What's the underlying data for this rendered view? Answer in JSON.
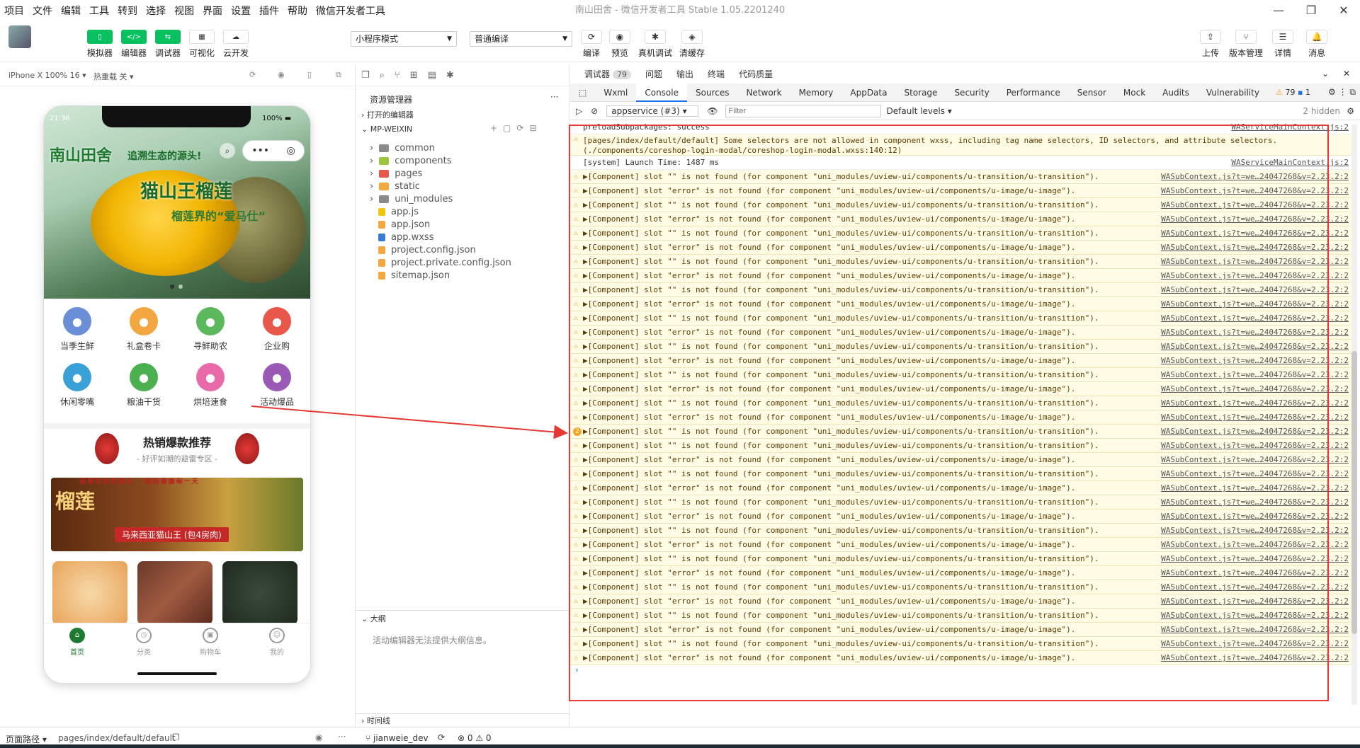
{
  "menu": {
    "items": [
      "项目",
      "文件",
      "编辑",
      "工具",
      "转到",
      "选择",
      "视图",
      "界面",
      "设置",
      "插件",
      "帮助",
      "微信开发者工具"
    ]
  },
  "window": {
    "title": "南山田舍 - 微信开发者工具 Stable 1.05.2201240"
  },
  "toolbar": {
    "left_buttons": [
      "模拟器",
      "编辑器",
      "调试器",
      "可视化",
      "云开发"
    ],
    "mode_select": "小程序模式",
    "compile_select": "普通编译",
    "mid_buttons": [
      "编译",
      "预览",
      "真机调试",
      "清缓存"
    ],
    "right_buttons": [
      "上传",
      "版本管理",
      "详情",
      "消息"
    ]
  },
  "simulator": {
    "device": "iPhone X 100% 16 ▾",
    "hotreload": "热重载 关 ▾",
    "status_time": "21:36",
    "battery": "100%",
    "logo": "南山田舍",
    "slogan": "追溯生态的源头!",
    "product_title": "猫山王榴莲",
    "product_sub": "榴莲界的“爱马仕”",
    "categories": [
      {
        "label": "当季生鲜",
        "color": "#6b8fd6"
      },
      {
        "label": "礼盒卷卡",
        "color": "#f4a640"
      },
      {
        "label": "寻鲜助农",
        "color": "#5cb85c"
      },
      {
        "label": "企业购",
        "color": "#e8574a"
      },
      {
        "label": "休闲零嘴",
        "color": "#3aa0d8"
      },
      {
        "label": "粮油干货",
        "color": "#4caf50"
      },
      {
        "label": "烘培速食",
        "color": "#e86aa8"
      },
      {
        "label": "活动爆品",
        "color": "#9b59b6"
      }
    ],
    "hot_title": "热销爆款推荐",
    "hot_sub": "- 好评如潮的避雷专区 -",
    "promo_top": "追溯生态的源头 · 链接健康每一天",
    "promo_big": "榴莲",
    "promo_tag": "马来西亚猫山王 (包4房肉)",
    "tabs": [
      "首页",
      "分类",
      "购物车",
      "我的"
    ]
  },
  "explorer": {
    "title": "资源管理器",
    "open_editors": "打开的编辑器",
    "root": "MP-WEIXIN",
    "files": [
      {
        "name": "common",
        "type": "folder",
        "color": "#8a8a8a"
      },
      {
        "name": "components",
        "type": "folder",
        "color": "#9bc53d"
      },
      {
        "name": "pages",
        "type": "folder",
        "color": "#e8574a"
      },
      {
        "name": "static",
        "type": "folder",
        "color": "#f4a640"
      },
      {
        "name": "uni_modules",
        "type": "folder",
        "color": "#8a8a8a"
      },
      {
        "name": "app.js",
        "type": "file",
        "color": "#f1c40f"
      },
      {
        "name": "app.json",
        "type": "file",
        "color": "#f4a640"
      },
      {
        "name": "app.wxss",
        "type": "file",
        "color": "#3a7bd5"
      },
      {
        "name": "project.config.json",
        "type": "file",
        "color": "#f4a640"
      },
      {
        "name": "project.private.config.json",
        "type": "file",
        "color": "#f4a640"
      },
      {
        "name": "sitemap.json",
        "type": "file",
        "color": "#f4a640"
      }
    ],
    "outline": "大纲",
    "outline_msg": "活动编辑器无法提供大纲信息。",
    "timeline": "时间线"
  },
  "devtools": {
    "top_tabs": [
      "调试器",
      "问题",
      "输出",
      "终端",
      "代码质量"
    ],
    "debugger_count": "79",
    "tabs": [
      "Wxml",
      "Console",
      "Sources",
      "Network",
      "Memory",
      "AppData",
      "Storage",
      "Security",
      "Performance",
      "Sensor",
      "Mock",
      "Audits",
      "Vulnerability"
    ],
    "active_tab": "Console",
    "warn_count": "79",
    "info_count": "1",
    "context": "appservice (#3)",
    "filter_placeholder": "Filter",
    "levels": "Default levels ▾",
    "hidden": "2 hidden",
    "lines": [
      {
        "kind": "info",
        "text": "preloadSubpackages: success",
        "src": "WAServiceMainContext.js:2"
      },
      {
        "kind": "warn_tall",
        "text": "[pages/index/default/default] Some selectors are not allowed in component wxss, including tag name selectors, ID selectors, and attribute selectors.(./components/coreshop-login-modal/coreshop-login-modal.wxss:140:12)",
        "src": ""
      },
      {
        "kind": "info",
        "text": "[system] Launch Time: 1487 ms",
        "src": "WAServiceMainContext.js:2"
      },
      {
        "kind": "warn",
        "slot": "",
        "comp": "uni_modules/uview-ui/components/u-transition/u-transition"
      },
      {
        "kind": "warn",
        "slot": "error",
        "comp": "uni_modules/uview-ui/components/u-image/u-image"
      },
      {
        "kind": "warn",
        "slot": "",
        "comp": "uni_modules/uview-ui/components/u-transition/u-transition"
      },
      {
        "kind": "warn",
        "slot": "error",
        "comp": "uni_modules/uview-ui/components/u-image/u-image"
      },
      {
        "kind": "warn",
        "slot": "",
        "comp": "uni_modules/uview-ui/components/u-transition/u-transition"
      },
      {
        "kind": "warn",
        "slot": "error",
        "comp": "uni_modules/uview-ui/components/u-image/u-image"
      },
      {
        "kind": "warn",
        "slot": "",
        "comp": "uni_modules/uview-ui/components/u-transition/u-transition"
      },
      {
        "kind": "warn",
        "slot": "error",
        "comp": "uni_modules/uview-ui/components/u-image/u-image"
      },
      {
        "kind": "warn",
        "slot": "",
        "comp": "uni_modules/uview-ui/components/u-transition/u-transition"
      },
      {
        "kind": "warn",
        "slot": "error",
        "comp": "uni_modules/uview-ui/components/u-image/u-image"
      },
      {
        "kind": "warn",
        "slot": "",
        "comp": "uni_modules/uview-ui/components/u-transition/u-transition"
      },
      {
        "kind": "warn",
        "slot": "error",
        "comp": "uni_modules/uview-ui/components/u-image/u-image"
      },
      {
        "kind": "warn",
        "slot": "",
        "comp": "uni_modules/uview-ui/components/u-transition/u-transition"
      },
      {
        "kind": "warn",
        "slot": "error",
        "comp": "uni_modules/uview-ui/components/u-image/u-image"
      },
      {
        "kind": "warn",
        "slot": "",
        "comp": "uni_modules/uview-ui/components/u-transition/u-transition"
      },
      {
        "kind": "warn",
        "slot": "error",
        "comp": "uni_modules/uview-ui/components/u-image/u-image"
      },
      {
        "kind": "warn",
        "slot": "",
        "comp": "uni_modules/uview-ui/components/u-transition/u-transition"
      },
      {
        "kind": "warn",
        "slot": "error",
        "comp": "uni_modules/uview-ui/components/u-image/u-image"
      },
      {
        "kind": "warn2",
        "slot": "",
        "comp": "uni_modules/uview-ui/components/u-transition/u-transition"
      },
      {
        "kind": "warn",
        "slot": "",
        "comp": "uni_modules/uview-ui/components/u-transition/u-transition"
      },
      {
        "kind": "warn",
        "slot": "error",
        "comp": "uni_modules/uview-ui/components/u-image/u-image"
      },
      {
        "kind": "warn",
        "slot": "",
        "comp": "uni_modules/uview-ui/components/u-transition/u-transition"
      },
      {
        "kind": "warn",
        "slot": "error",
        "comp": "uni_modules/uview-ui/components/u-image/u-image"
      },
      {
        "kind": "warn",
        "slot": "",
        "comp": "uni_modules/uview-ui/components/u-transition/u-transition"
      },
      {
        "kind": "warn",
        "slot": "error",
        "comp": "uni_modules/uview-ui/components/u-image/u-image"
      },
      {
        "kind": "warn",
        "slot": "",
        "comp": "uni_modules/uview-ui/components/u-transition/u-transition"
      },
      {
        "kind": "warn",
        "slot": "error",
        "comp": "uni_modules/uview-ui/components/u-image/u-image"
      },
      {
        "kind": "warn",
        "slot": "",
        "comp": "uni_modules/uview-ui/components/u-transition/u-transition"
      },
      {
        "kind": "warn",
        "slot": "error",
        "comp": "uni_modules/uview-ui/components/u-image/u-image"
      },
      {
        "kind": "warn",
        "slot": "",
        "comp": "uni_modules/uview-ui/components/u-transition/u-transition"
      },
      {
        "kind": "warn",
        "slot": "error",
        "comp": "uni_modules/uview-ui/components/u-image/u-image"
      },
      {
        "kind": "warn",
        "slot": "",
        "comp": "uni_modules/uview-ui/components/u-transition/u-transition"
      },
      {
        "kind": "warn",
        "slot": "error",
        "comp": "uni_modules/uview-ui/components/u-image/u-image"
      },
      {
        "kind": "warn",
        "slot": "",
        "comp": "uni_modules/uview-ui/components/u-transition/u-transition"
      },
      {
        "kind": "warn",
        "slot": "error",
        "comp": "uni_modules/uview-ui/components/u-image/u-image"
      }
    ],
    "warn_src": "WASubContext.js?t=we…24047268&v=2.23.2:2",
    "warn2_count": "2"
  },
  "status": {
    "path_label": "页面路径 ▾",
    "path": "pages/index/default/default",
    "branch": "jianweie_dev",
    "errors": "0",
    "warnings": "0"
  },
  "colors": {
    "accent": "#07c160",
    "highlight": "#e53935",
    "tab_active": "#1a73e8"
  }
}
